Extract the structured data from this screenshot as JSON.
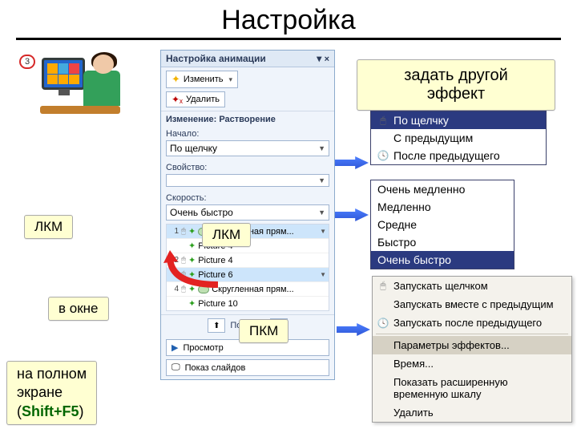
{
  "page": {
    "title": "Настройка",
    "slide_number": "3"
  },
  "callouts": {
    "top_right": "задать другой эффект",
    "lkm1": "ЛКМ",
    "lkm2": "ЛКМ",
    "pkm": "ПКМ",
    "in_window": "в окне",
    "fullscreen_line1": "на полном",
    "fullscreen_line2": "экране",
    "fullscreen_line3_open": "(",
    "fullscreen_line3_shift": "Shift+F5",
    "fullscreen_line3_close": ")"
  },
  "pane": {
    "title": "Настройка анимации",
    "btn_change": "Изменить",
    "btn_delete": "Удалить",
    "section_change": "Изменение: Растворение",
    "label_start": "Начало:",
    "start_value": "По щелчку",
    "label_property": "Свойство:",
    "property_value": "",
    "label_speed": "Скорость:",
    "speed_value": "Очень быстро",
    "effects": [
      {
        "idx": "1",
        "name": "Скругленная прям..."
      },
      {
        "idx": "",
        "name": "Picture 4"
      },
      {
        "idx": "2",
        "name": "Picture 4"
      },
      {
        "idx": "3",
        "name": "Picture 6"
      },
      {
        "idx": "4",
        "name": "Скругленная прям..."
      },
      {
        "idx": "",
        "name": "Picture 10"
      }
    ],
    "reorder_label": "Порядок",
    "btn_preview": "Просмотр",
    "btn_slideshow": "Показ слайдов"
  },
  "start_options": {
    "opt1": "По щелчку",
    "opt2": "С предыдущим",
    "opt3": "После предыдущего"
  },
  "speed_options": {
    "opt1": "Очень медленно",
    "opt2": "Медленно",
    "opt3": "Средне",
    "opt4": "Быстро",
    "opt5": "Очень быстро"
  },
  "context_menu": {
    "m1": "Запускать щелчком",
    "m2": "Запускать вместе с предыдущим",
    "m3": "Запускать после предыдущего",
    "m4": "Параметры эффектов...",
    "m5": "Время...",
    "m6": "Показать расширенную временную шкалу",
    "m7": "Удалить"
  }
}
